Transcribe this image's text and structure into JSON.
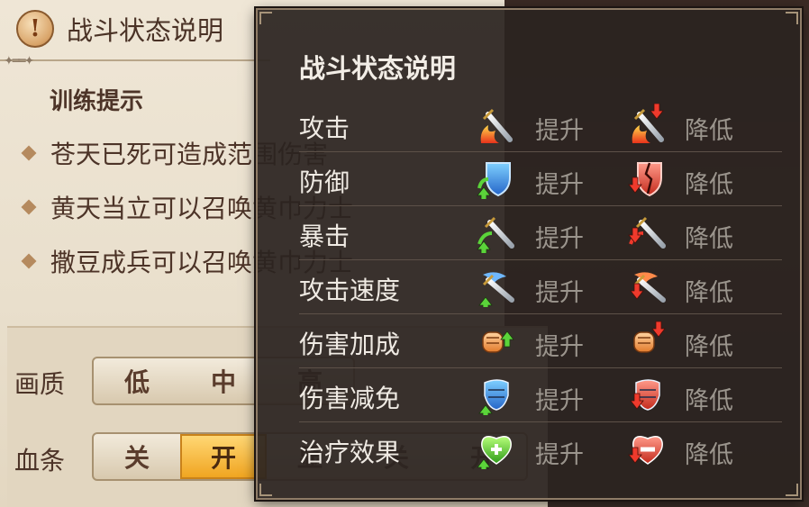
{
  "background_panel": {
    "header_title": "战斗状态说明",
    "warning_symbol": "!",
    "tips_title": "训练提示",
    "tips": [
      "苍天已死可造成范围伤害",
      "黄天当立可以召唤黄巾力士",
      "撒豆成兵可以召唤黄巾力士"
    ],
    "settings": [
      {
        "label": "画质",
        "options": [
          "低",
          "中",
          "高"
        ],
        "selected": "中"
      },
      {
        "label": "血条",
        "options": [
          "关",
          "开",
          "显",
          "关",
          "开"
        ],
        "selected": "开"
      }
    ]
  },
  "popup": {
    "title": "战斗状态说明",
    "rows": [
      {
        "name": "攻击",
        "up_icon": "sword-fire-up-icon",
        "up_label": "提升",
        "down_icon": "sword-fire-down-icon",
        "down_label": "降低"
      },
      {
        "name": "防御",
        "up_icon": "shield-up-icon",
        "up_label": "提升",
        "down_icon": "shield-broken-down-icon",
        "down_label": "降低"
      },
      {
        "name": "暴击",
        "up_icon": "critical-sword-up-icon",
        "up_label": "提升",
        "down_icon": "critical-sword-down-icon",
        "down_label": "降低"
      },
      {
        "name": "攻击速度",
        "up_icon": "wing-sword-up-icon",
        "up_label": "提升",
        "down_icon": "wing-sword-down-icon",
        "down_label": "降低"
      },
      {
        "name": "伤害加成",
        "up_icon": "fist-up-icon",
        "up_label": "提升",
        "down_icon": "fist-down-icon",
        "down_label": "降低"
      },
      {
        "name": "伤害减免",
        "up_icon": "armor-up-icon",
        "up_label": "提升",
        "down_icon": "armor-down-icon",
        "down_label": "降低"
      },
      {
        "name": "治疗效果",
        "up_icon": "heart-plus-up-icon",
        "up_label": "提升",
        "down_icon": "heart-minus-down-icon",
        "down_label": "降低"
      }
    ]
  },
  "colors": {
    "popup_bg": "#2b2420",
    "popup_border": "#8f7c67",
    "row_name": "#efeae3",
    "row_label": "#9b958d",
    "arrow_up": "#5bd43a",
    "arrow_down": "#ef3a2c",
    "accent_button": "#f0a521"
  }
}
